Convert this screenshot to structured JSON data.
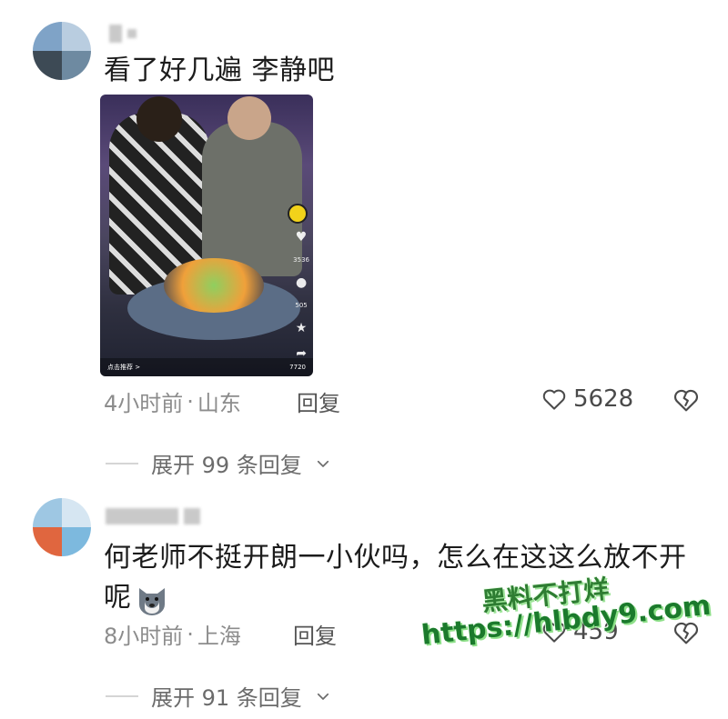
{
  "comments": [
    {
      "text": "看了好几遍 李静吧",
      "time": "4小时前",
      "location": "山东",
      "reply_label": "回复",
      "likes": "5628",
      "expand_label": "展开 99 条回复",
      "video": {
        "bottom_left": "点击推荐 >",
        "bottom_right": "7720",
        "side_counts": [
          "3536",
          "505"
        ]
      }
    },
    {
      "text": "何老师不挺开朗一小伙吗，怎么在这这么放不开呢",
      "time": "8小时前",
      "location": "上海",
      "reply_label": "回复",
      "likes": "459",
      "expand_label": "展开 91 条回复"
    }
  ],
  "meta_separator": "·",
  "watermark": {
    "line1": "黑料不打烊",
    "line2": "https://hlbdy9.com"
  },
  "colors": {
    "text": "#1c1c1c",
    "meta": "#8c8c8c",
    "watermark": "#2e7d32"
  }
}
